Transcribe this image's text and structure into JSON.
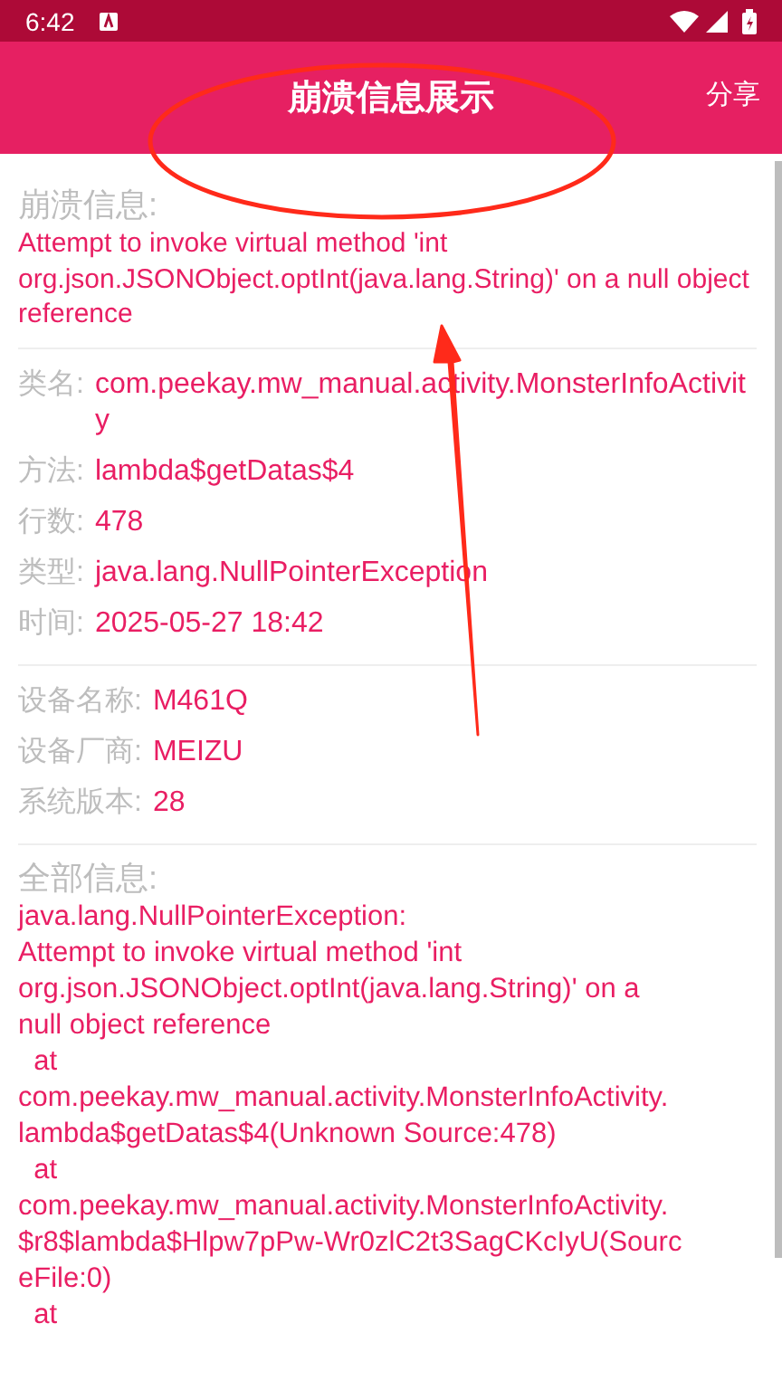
{
  "status_bar": {
    "time": "6:42"
  },
  "app_bar": {
    "title": "崩溃信息展示",
    "action": "分享"
  },
  "crash_info": {
    "label": "崩溃信息:",
    "message": "Attempt to invoke virtual method 'int org.json.JSONObject.optInt(java.lang.String)' on a null object reference"
  },
  "details": [
    {
      "label": "类名:",
      "value": "com.peekay.mw_manual.activity.MonsterInfoActivity"
    },
    {
      "label": "方法:",
      "value": "lambda$getDatas$4"
    },
    {
      "label": "行数:",
      "value": "478"
    },
    {
      "label": "类型:",
      "value": "java.lang.NullPointerException"
    },
    {
      "label": "时间:",
      "value": "2025-05-27 18:42"
    }
  ],
  "device": [
    {
      "label": "设备名称:",
      "value": "M461Q"
    },
    {
      "label": "设备厂商:",
      "value": "MEIZU"
    },
    {
      "label": "系统版本:",
      "value": "28"
    }
  ],
  "full_info": {
    "label": "全部信息:",
    "text": "java.lang.NullPointerException:\nAttempt to invoke virtual method 'int\norg.json.JSONObject.optInt(java.lang.String)' on a\nnull object reference\n  at\ncom.peekay.mw_manual.activity.MonsterInfoActivity.\nlambda$getDatas$4(Unknown Source:478)\n  at\ncom.peekay.mw_manual.activity.MonsterInfoActivity.\n$r8$lambda$Hlpw7pPw-Wr0zlC2t3SagCKcIyU(Sourc\neFile:0)\n  at"
  }
}
